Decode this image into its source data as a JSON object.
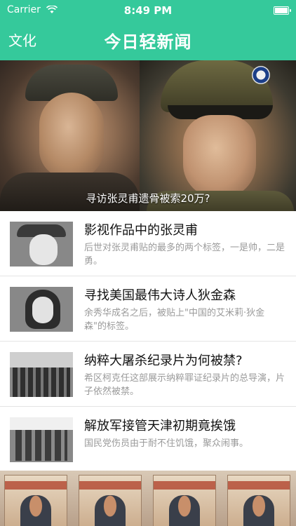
{
  "status_bar": {
    "carrier": "Carrier",
    "time": "8:49 PM",
    "icons": [
      "wifi-icon",
      "battery-icon"
    ]
  },
  "nav": {
    "left_label": "文化",
    "title": "今日轻新闻"
  },
  "hero": {
    "caption": "寻访张灵甫遗骨被索20万?"
  },
  "articles": [
    {
      "title": "影视作品中的张灵甫",
      "desc": "后世对张灵甫贴的最多的两个标签，一是帅，二是勇。"
    },
    {
      "title": "寻找美国最伟大诗人狄金森",
      "desc": "余秀华成名之后，被贴上\"中国的艾米莉·狄金森\"的标签。"
    },
    {
      "title": "纳粹大屠杀纪录片为何被禁?",
      "desc": "希区柯克任这部展示纳粹罪证纪录片的总导演，片子依然被禁。"
    },
    {
      "title": "解放军接管天津初期竟挨饿",
      "desc": "国民党伤员由于耐不住饥饿，聚众闹事。"
    }
  ],
  "colors": {
    "accent": "#35c99b",
    "title_text": "#111111",
    "desc_text": "#9a9a9a"
  }
}
